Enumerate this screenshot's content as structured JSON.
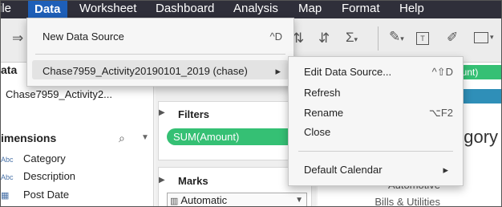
{
  "menubar": {
    "items": [
      "ile",
      "Data",
      "Worksheet",
      "Dashboard",
      "Analysis",
      "Map",
      "Format",
      "Help"
    ]
  },
  "data_pane": {
    "title": "ata",
    "data_source_name": "Chase7959_Activity2...",
    "dimensions_label": "imensions",
    "fields": [
      {
        "type": "Abc",
        "name": "Category"
      },
      {
        "type": "Abc",
        "name": "Description"
      },
      {
        "type": "date",
        "name": "Post Date"
      }
    ]
  },
  "filters": {
    "title": "Filters",
    "pill": "SUM(Amount)"
  },
  "marks": {
    "title": "Marks",
    "type_value": "Automatic"
  },
  "canvas": {
    "header_text": "ount)",
    "big_title": "egory",
    "row_labels": [
      "Automotive",
      "Bills & Utilities"
    ]
  },
  "data_menu": {
    "new_data_source": "New Data Source",
    "new_data_source_shortcut": "^D",
    "data_source_item": "Chase7959_Activity20190101_2019 (chase)"
  },
  "submenu": {
    "edit": "Edit Data Source...",
    "edit_shortcut": "^⇧D",
    "refresh": "Refresh",
    "rename": "Rename",
    "rename_shortcut": "⌥F2",
    "close": "Close",
    "default_calendar": "Default Calendar"
  },
  "colors": {
    "menubar": "#2f2f3a",
    "active_menu": "#1e5fb8",
    "pill_green": "#35c074",
    "canvas_blue": "#2f8fb8"
  }
}
